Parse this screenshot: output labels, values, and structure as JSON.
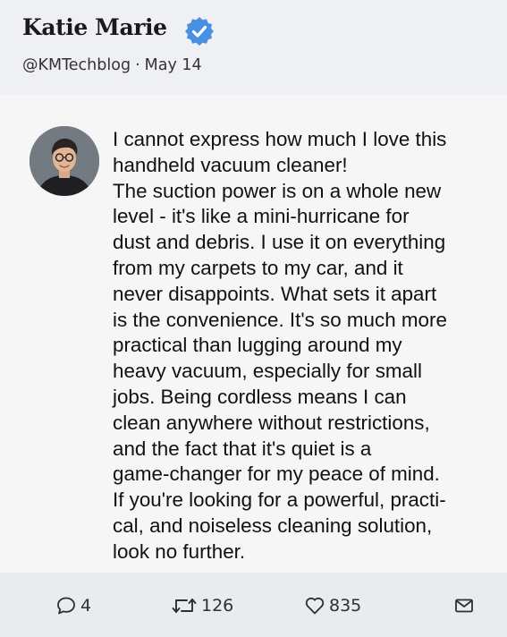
{
  "author": {
    "name": "Katie Marie",
    "handle": "@KMTechblog",
    "separator": "·",
    "date": "May 14",
    "verified_icon": "verified-badge-icon",
    "accent_color": "#4a90e2"
  },
  "tweet": {
    "lines": [
      "I cannot express how much I love this",
      "handheld vacuum cleaner!",
      "The suction power is on a whole new",
      "level - it's like a mini-hurricane for",
      "dust and debris. I use it on everything",
      "from my carpets to my car, and it",
      "never disappoints. What sets it apart",
      "is the convenience. It's so much more",
      "practical than lugging around my",
      "heavy vacuum, especially for small",
      "jobs. Being cordless means I can",
      "clean anywhere without restrictions,",
      "and the fact that it's quiet is a",
      "game-changer for my peace of mind.",
      "If you're looking for a powerful, practi-",
      "cal, and noiseless cleaning solution,",
      "look no further."
    ]
  },
  "actions": {
    "reply": {
      "icon": "reply-bubble-icon",
      "count": "4"
    },
    "retweet": {
      "icon": "retweet-icon",
      "count": "126"
    },
    "like": {
      "icon": "heart-icon",
      "count": "835"
    },
    "share": {
      "icon": "envelope-icon"
    }
  }
}
